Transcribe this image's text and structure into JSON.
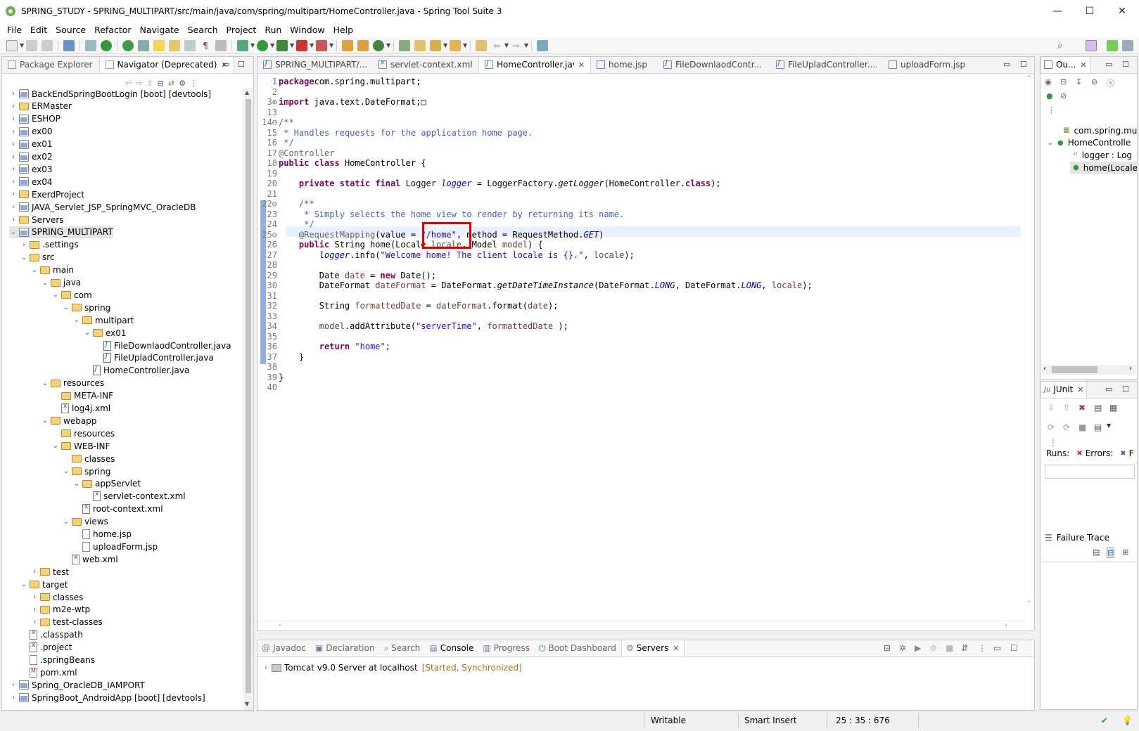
{
  "window": {
    "title": "SPRING_STUDY - SPRING_MULTIPART/src/main/java/com/spring/multipart/HomeController.java - Spring Tool Suite 3",
    "minimize": "—",
    "maximize": "☐",
    "close": "✕"
  },
  "menu": [
    "File",
    "Edit",
    "Source",
    "Refactor",
    "Navigate",
    "Search",
    "Project",
    "Run",
    "Window",
    "Help"
  ],
  "left_panel": {
    "tabs": [
      "Package Explorer",
      "Navigator (Deprecated)"
    ],
    "tree": [
      {
        "label": "BackEndSpringBootLogin [boot] [devtools]",
        "depth": 0,
        "icon": "project",
        "tw": "›"
      },
      {
        "label": "ERMaster",
        "depth": 0,
        "icon": "folder",
        "tw": "›"
      },
      {
        "label": "ESHOP",
        "depth": 0,
        "icon": "project",
        "tw": "›"
      },
      {
        "label": "ex00",
        "depth": 0,
        "icon": "project",
        "tw": "›"
      },
      {
        "label": "ex01",
        "depth": 0,
        "icon": "project",
        "tw": "›"
      },
      {
        "label": "ex02",
        "depth": 0,
        "icon": "project",
        "tw": "›"
      },
      {
        "label": "ex03",
        "depth": 0,
        "icon": "project",
        "tw": "›"
      },
      {
        "label": "ex04",
        "depth": 0,
        "icon": "project",
        "tw": "›"
      },
      {
        "label": "ExerdProject",
        "depth": 0,
        "icon": "folder",
        "tw": "›"
      },
      {
        "label": "JAVA_Servlet_JSP_SpringMVC_OracleDB",
        "depth": 0,
        "icon": "project",
        "tw": "›"
      },
      {
        "label": "Servers",
        "depth": 0,
        "icon": "folder",
        "tw": "›"
      },
      {
        "label": "SPRING_MULTIPART",
        "depth": 0,
        "icon": "project",
        "tw": "⌄",
        "selected": true
      },
      {
        "label": ".settings",
        "depth": 1,
        "icon": "folder",
        "tw": "›"
      },
      {
        "label": "src",
        "depth": 1,
        "icon": "folder",
        "tw": "⌄"
      },
      {
        "label": "main",
        "depth": 2,
        "icon": "folder",
        "tw": "⌄"
      },
      {
        "label": "java",
        "depth": 3,
        "icon": "folder",
        "tw": "⌄"
      },
      {
        "label": "com",
        "depth": 4,
        "icon": "folder",
        "tw": "⌄"
      },
      {
        "label": "spring",
        "depth": 5,
        "icon": "folder",
        "tw": "⌄"
      },
      {
        "label": "multipart",
        "depth": 6,
        "icon": "folder",
        "tw": "⌄"
      },
      {
        "label": "ex01",
        "depth": 7,
        "icon": "folder",
        "tw": "⌄"
      },
      {
        "label": "FileDownlaodController.java",
        "depth": 8,
        "icon": "java",
        "tw": ""
      },
      {
        "label": "FileUpladController.java",
        "depth": 8,
        "icon": "java",
        "tw": ""
      },
      {
        "label": "HomeController.java",
        "depth": 7,
        "icon": "java",
        "tw": ""
      },
      {
        "label": "resources",
        "depth": 3,
        "icon": "folder",
        "tw": "⌄"
      },
      {
        "label": "META-INF",
        "depth": 4,
        "icon": "folder",
        "tw": ""
      },
      {
        "label": "log4j.xml",
        "depth": 4,
        "icon": "xml",
        "tw": ""
      },
      {
        "label": "webapp",
        "depth": 3,
        "icon": "folder",
        "tw": "⌄"
      },
      {
        "label": "resources",
        "depth": 4,
        "icon": "folder",
        "tw": ""
      },
      {
        "label": "WEB-INF",
        "depth": 4,
        "icon": "folder",
        "tw": "⌄"
      },
      {
        "label": "classes",
        "depth": 5,
        "icon": "folder",
        "tw": ""
      },
      {
        "label": "spring",
        "depth": 5,
        "icon": "folder",
        "tw": "⌄"
      },
      {
        "label": "appServlet",
        "depth": 6,
        "icon": "folder",
        "tw": "⌄"
      },
      {
        "label": "servlet-context.xml",
        "depth": 7,
        "icon": "xml",
        "tw": ""
      },
      {
        "label": "root-context.xml",
        "depth": 6,
        "icon": "xml",
        "tw": ""
      },
      {
        "label": "views",
        "depth": 5,
        "icon": "folder",
        "tw": "⌄"
      },
      {
        "label": "home.jsp",
        "depth": 6,
        "icon": "file",
        "tw": ""
      },
      {
        "label": "uploadForm.jsp",
        "depth": 6,
        "icon": "file",
        "tw": ""
      },
      {
        "label": "web.xml",
        "depth": 5,
        "icon": "xml",
        "tw": ""
      },
      {
        "label": "test",
        "depth": 2,
        "icon": "folder",
        "tw": "›"
      },
      {
        "label": "target",
        "depth": 1,
        "icon": "folder",
        "tw": "⌄"
      },
      {
        "label": "classes",
        "depth": 2,
        "icon": "folder",
        "tw": "›"
      },
      {
        "label": "m2e-wtp",
        "depth": 2,
        "icon": "folder",
        "tw": "›"
      },
      {
        "label": "test-classes",
        "depth": 2,
        "icon": "folder",
        "tw": "›"
      },
      {
        "label": ".classpath",
        "depth": 1,
        "icon": "xml",
        "tw": ""
      },
      {
        "label": ".project",
        "depth": 1,
        "icon": "xml",
        "tw": ""
      },
      {
        "label": ".springBeans",
        "depth": 1,
        "icon": "file",
        "tw": ""
      },
      {
        "label": "pom.xml",
        "depth": 1,
        "icon": "maven",
        "tw": ""
      },
      {
        "label": "Spring_OracleDB_IAMPORT",
        "depth": 0,
        "icon": "project",
        "tw": "›"
      },
      {
        "label": "SpringBoot_AndroidApp [boot] [devtools]",
        "depth": 0,
        "icon": "project",
        "tw": "›"
      }
    ]
  },
  "editor": {
    "tabs": [
      {
        "label": "SPRING_MULTIPART/...",
        "icon": "java",
        "active": false
      },
      {
        "label": "servlet-context.xml",
        "icon": "xml",
        "active": false
      },
      {
        "label": "HomeController.java",
        "icon": "java",
        "active": true
      },
      {
        "label": "home.jsp",
        "icon": "file",
        "active": false
      },
      {
        "label": "FileDownlaodContr...",
        "icon": "java",
        "active": false
      },
      {
        "label": "FileUpladController....",
        "icon": "java",
        "active": false
      },
      {
        "label": "uploadForm.jsp",
        "icon": "file",
        "active": false
      }
    ],
    "lines": [
      {
        "n": "1",
        "code": [
          [
            "kw",
            "package"
          ],
          [
            "",
            "com.spring.multipart;"
          ]
        ]
      },
      {
        "n": "2",
        "code": []
      },
      {
        "n": "3⊕",
        "code": [
          [
            "kw",
            "import"
          ],
          [
            "",
            " java.text.DateFormat;"
          ],
          [
            "",
            "□"
          ]
        ]
      },
      {
        "n": "13",
        "code": []
      },
      {
        "n": "14⊖",
        "code": [
          [
            "cm",
            "/**"
          ]
        ]
      },
      {
        "n": "15",
        "code": [
          [
            "cm",
            " * Handles requests for the application home page."
          ]
        ]
      },
      {
        "n": "16",
        "code": [
          [
            "cm",
            " */"
          ]
        ]
      },
      {
        "n": "17",
        "code": [
          [
            "an",
            "@Controller"
          ]
        ]
      },
      {
        "n": "18",
        "code": [
          [
            "kw",
            "public"
          ],
          [
            "",
            " "
          ],
          [
            "kw",
            "class"
          ],
          [
            "",
            " HomeController {"
          ]
        ]
      },
      {
        "n": "19",
        "code": []
      },
      {
        "n": "20",
        "code": [
          [
            "",
            "    "
          ],
          [
            "kw",
            "private"
          ],
          [
            "",
            " "
          ],
          [
            "kw",
            "static"
          ],
          [
            "",
            " "
          ],
          [
            "kw",
            "final"
          ],
          [
            "",
            " Logger "
          ],
          [
            "fld",
            "logger"
          ],
          [
            "",
            " = LoggerFactory."
          ],
          [
            "it",
            "getLogger"
          ],
          [
            "",
            "(HomeController."
          ],
          [
            "kw",
            "class"
          ],
          [
            "",
            ");"
          ]
        ]
      },
      {
        "n": "21",
        "code": []
      },
      {
        "n": "22⊖",
        "code": [
          [
            "",
            "    "
          ],
          [
            "cm",
            "/**"
          ]
        ]
      },
      {
        "n": "23",
        "code": [
          [
            "cm",
            "     * Simply selects the home view to render by returning its name."
          ]
        ]
      },
      {
        "n": "24",
        "code": [
          [
            "cm",
            "     */"
          ]
        ]
      },
      {
        "n": "25⊖",
        "code": [
          [
            "",
            "    "
          ],
          [
            "an",
            "@RequestMapping"
          ],
          [
            "",
            "(value = "
          ],
          [
            "st",
            "\"/home\""
          ],
          [
            "",
            ", method = RequestMethod."
          ],
          [
            "fld",
            "GET"
          ],
          [
            "",
            ")"
          ]
        ]
      },
      {
        "n": "26",
        "code": [
          [
            "",
            "    "
          ],
          [
            "kw",
            "public"
          ],
          [
            "",
            " String home(Locale "
          ],
          [
            "var",
            "locale"
          ],
          [
            "",
            ", Model "
          ],
          [
            "var",
            "model"
          ],
          [
            "",
            ") {"
          ]
        ]
      },
      {
        "n": "27",
        "code": [
          [
            "",
            "        "
          ],
          [
            "fld",
            "logger"
          ],
          [
            "",
            ".info("
          ],
          [
            "st",
            "\"Welcome home! The client locale is {}.\""
          ],
          [
            "",
            ", "
          ],
          [
            "var",
            "locale"
          ],
          [
            "",
            ");"
          ]
        ]
      },
      {
        "n": "28",
        "code": []
      },
      {
        "n": "29",
        "code": [
          [
            "",
            "        Date "
          ],
          [
            "var",
            "date"
          ],
          [
            "",
            " = "
          ],
          [
            "kw",
            "new"
          ],
          [
            "",
            " Date();"
          ]
        ]
      },
      {
        "n": "30",
        "code": [
          [
            "",
            "        DateFormat "
          ],
          [
            "var",
            "dateFormat"
          ],
          [
            "",
            " = DateFormat."
          ],
          [
            "it",
            "getDateTimeInstance"
          ],
          [
            "",
            "(DateFormat."
          ],
          [
            "fld",
            "LONG"
          ],
          [
            "",
            ", DateFormat."
          ],
          [
            "fld",
            "LONG"
          ],
          [
            "",
            ", "
          ],
          [
            "var",
            "locale"
          ],
          [
            "",
            ");"
          ]
        ]
      },
      {
        "n": "31",
        "code": []
      },
      {
        "n": "32",
        "code": [
          [
            "",
            "        String "
          ],
          [
            "var",
            "formattedDate"
          ],
          [
            "",
            " = "
          ],
          [
            "var",
            "dateFormat"
          ],
          [
            "",
            ".format("
          ],
          [
            "var",
            "date"
          ],
          [
            "",
            ");"
          ]
        ]
      },
      {
        "n": "33",
        "code": []
      },
      {
        "n": "34",
        "code": [
          [
            "",
            "        "
          ],
          [
            "var",
            "model"
          ],
          [
            "",
            ".addAttribute("
          ],
          [
            "st",
            "\"serverTime\""
          ],
          [
            "",
            ", "
          ],
          [
            "var",
            "formattedDate"
          ],
          [
            "",
            " );"
          ]
        ]
      },
      {
        "n": "35",
        "code": []
      },
      {
        "n": "36",
        "code": [
          [
            "",
            "        "
          ],
          [
            "kw",
            "return"
          ],
          [
            "",
            " "
          ],
          [
            "st",
            "\"home\""
          ],
          [
            "",
            ";"
          ]
        ]
      },
      {
        "n": "37",
        "code": [
          [
            "",
            "    }"
          ]
        ]
      },
      {
        "n": "38",
        "code": []
      },
      {
        "n": "39",
        "code": [
          [
            "",
            "}"
          ]
        ]
      },
      {
        "n": "40",
        "code": []
      }
    ]
  },
  "outline": {
    "tab": "Ou...",
    "items": [
      {
        "label": "com.spring.mu",
        "icon": "package"
      },
      {
        "label": "HomeControlle",
        "icon": "class"
      },
      {
        "label": "logger : Log",
        "icon": "field"
      },
      {
        "label": "home(Locale",
        "icon": "method",
        "selected": true
      }
    ]
  },
  "junit": {
    "tab": "JUnit",
    "runs": "Runs:",
    "errors": "Errors:",
    "failures": "F",
    "failure_trace": "Failure Trace"
  },
  "bottom_panel": {
    "tabs": [
      "Javadoc",
      "Declaration",
      "Search",
      "Console",
      "Progress",
      "Boot Dashboard",
      "Servers"
    ],
    "active_tab": "Servers",
    "server_name": "Tomcat v9.0 Server at localhost",
    "server_state": "[Started, Synchronized]"
  },
  "status": {
    "writable": "Writable",
    "insert_mode": "Smart Insert",
    "position": "25 : 35 : 676"
  },
  "colors": {
    "keyword": "#7f0055",
    "comment": "#3f5fbf",
    "string": "#2a00ff",
    "highlight_box": "#e00000"
  }
}
